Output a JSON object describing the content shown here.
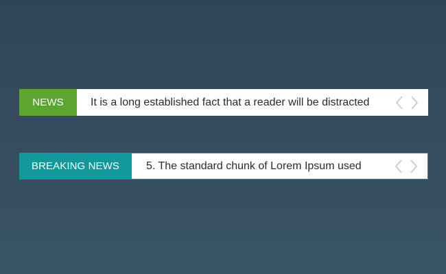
{
  "tickers": [
    {
      "label": "NEWS",
      "label_color": "#5aa630",
      "headline": "It is a long established fact that a reader will be distracted",
      "prev_icon": "chevron-left-icon",
      "next_icon": "chevron-right-icon"
    },
    {
      "label": "BREAKING NEWS",
      "label_color": "#12979b",
      "headline": "5. The standard chunk of Lorem Ipsum used",
      "prev_icon": "chevron-left-icon",
      "next_icon": "chevron-right-icon"
    }
  ]
}
